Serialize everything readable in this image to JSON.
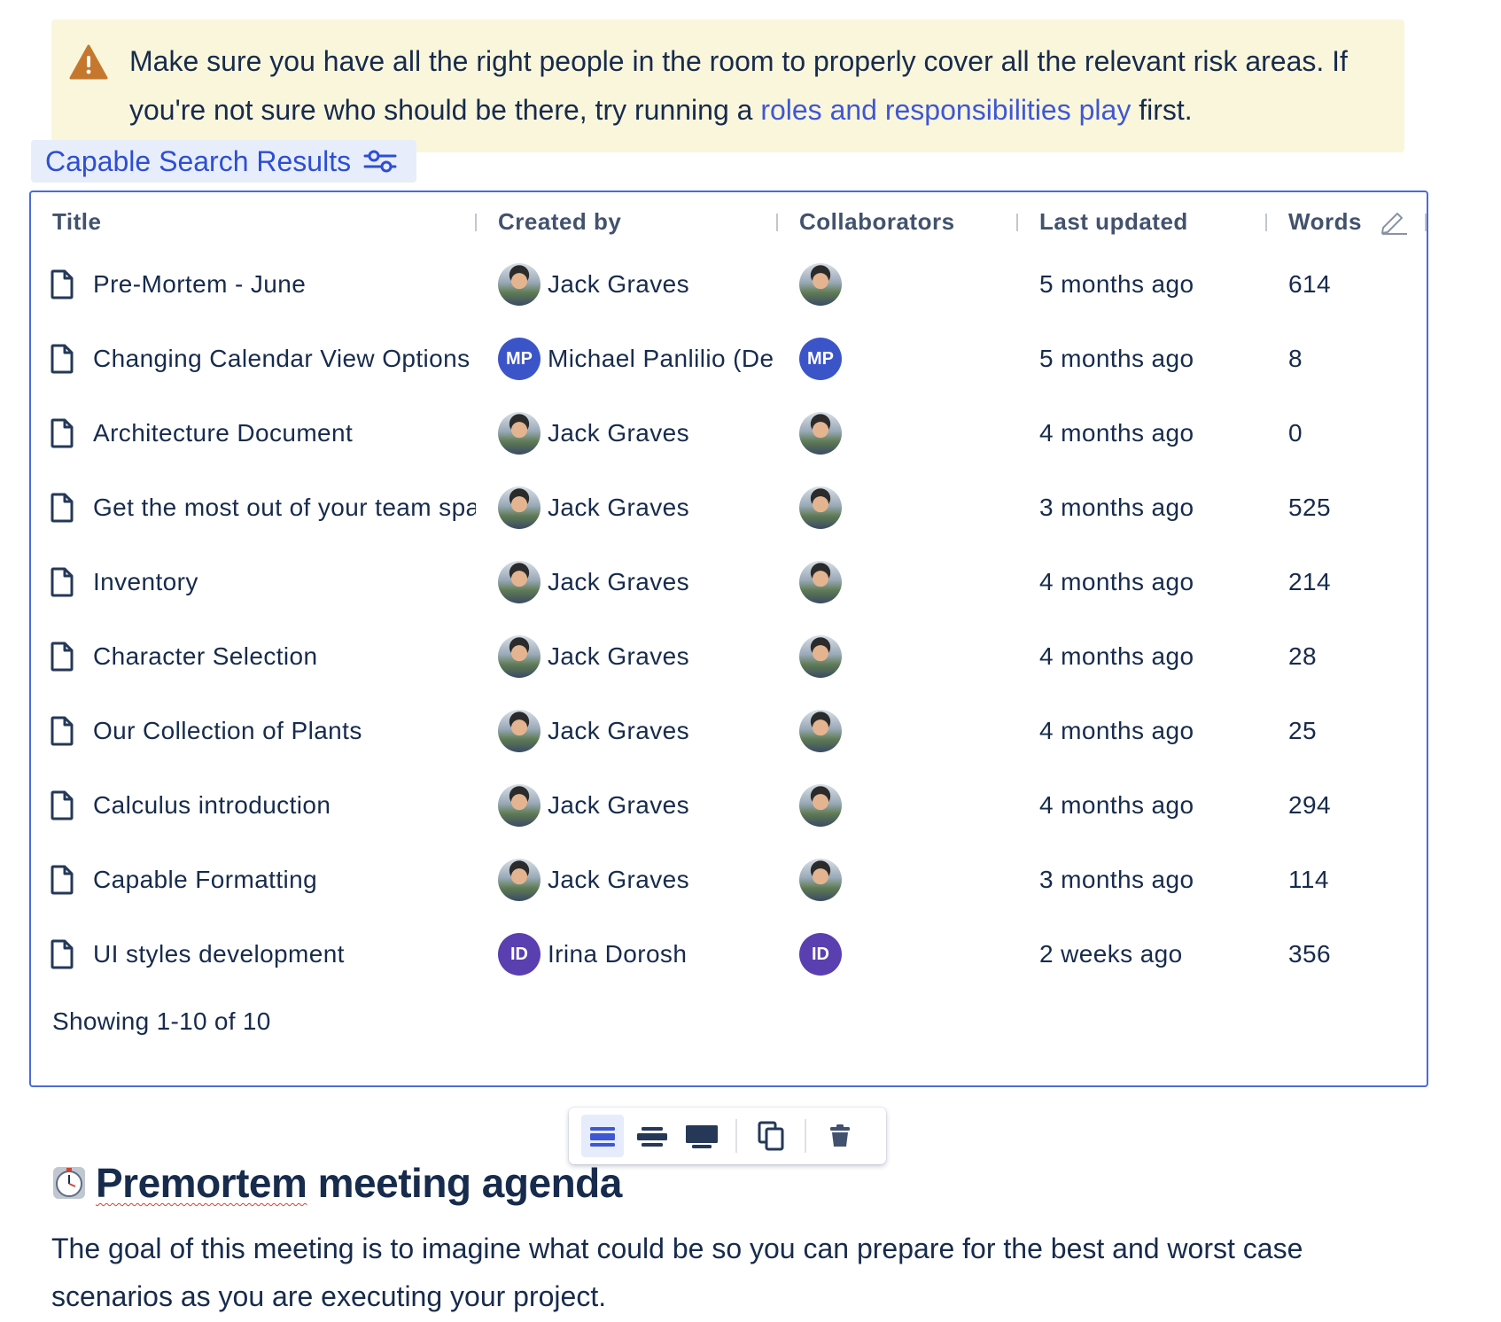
{
  "panel": {
    "text_before": "Make sure you have all the right people in the room to properly cover all the relevant risk areas. If you're not sure who should be there, try running a ",
    "link_text": "roles and responsibilities play",
    "text_after": " first.",
    "icon": "warning-icon"
  },
  "macro": {
    "label": "Capable Search Results",
    "icon": "filter-sliders-icon"
  },
  "table": {
    "columns": {
      "title": "Title",
      "created_by": "Created by",
      "collaborators": "Collaborators",
      "last_updated": "Last updated",
      "words": "Words"
    },
    "rows": [
      {
        "title": "Pre-Mortem - June",
        "creator": "Jack Graves",
        "avatar": "photo",
        "initials": "",
        "updated": "5 months ago",
        "words": "614"
      },
      {
        "title": "Changing Calendar View Options",
        "creator": "Michael Panlilio (Deactivated)",
        "avatar": "mp",
        "initials": "MP",
        "updated": "5 months ago",
        "words": "8"
      },
      {
        "title": "Architecture Document",
        "creator": "Jack Graves",
        "avatar": "photo",
        "initials": "",
        "updated": "4 months ago",
        "words": "0"
      },
      {
        "title": "Get the most out of your team space",
        "creator": "Jack Graves",
        "avatar": "photo",
        "initials": "",
        "updated": "3 months ago",
        "words": "525"
      },
      {
        "title": "Inventory",
        "creator": "Jack Graves",
        "avatar": "photo",
        "initials": "",
        "updated": "4 months ago",
        "words": "214"
      },
      {
        "title": "Character Selection",
        "creator": "Jack Graves",
        "avatar": "photo",
        "initials": "",
        "updated": "4 months ago",
        "words": "28"
      },
      {
        "title": "Our Collection of Plants",
        "creator": "Jack Graves",
        "avatar": "photo",
        "initials": "",
        "updated": "4 months ago",
        "words": "25"
      },
      {
        "title": "Calculus introduction",
        "creator": "Jack Graves",
        "avatar": "photo",
        "initials": "",
        "updated": "4 months ago",
        "words": "294"
      },
      {
        "title": "Capable Formatting",
        "creator": "Jack Graves",
        "avatar": "photo",
        "initials": "",
        "updated": "3 months ago",
        "words": "114"
      },
      {
        "title": "UI styles development",
        "creator": "Irina Dorosh",
        "avatar": "id",
        "initials": "ID",
        "updated": "2 weeks ago",
        "words": "356"
      }
    ],
    "footer": "Showing 1-10 of 10"
  },
  "toolbar": {
    "buttons": [
      "layout-default-icon",
      "layout-wide-icon",
      "layout-full-width-icon",
      "copy-icon",
      "delete-icon"
    ],
    "active": "layout-default-icon"
  },
  "heading": {
    "emoji": "stopwatch-icon",
    "word1": "Premortem",
    "rest": " meeting agenda"
  },
  "paragraph": "The goal of this meeting is to imagine what could be so you can prepare for the best and worst case scenarios as you are executing your project."
}
